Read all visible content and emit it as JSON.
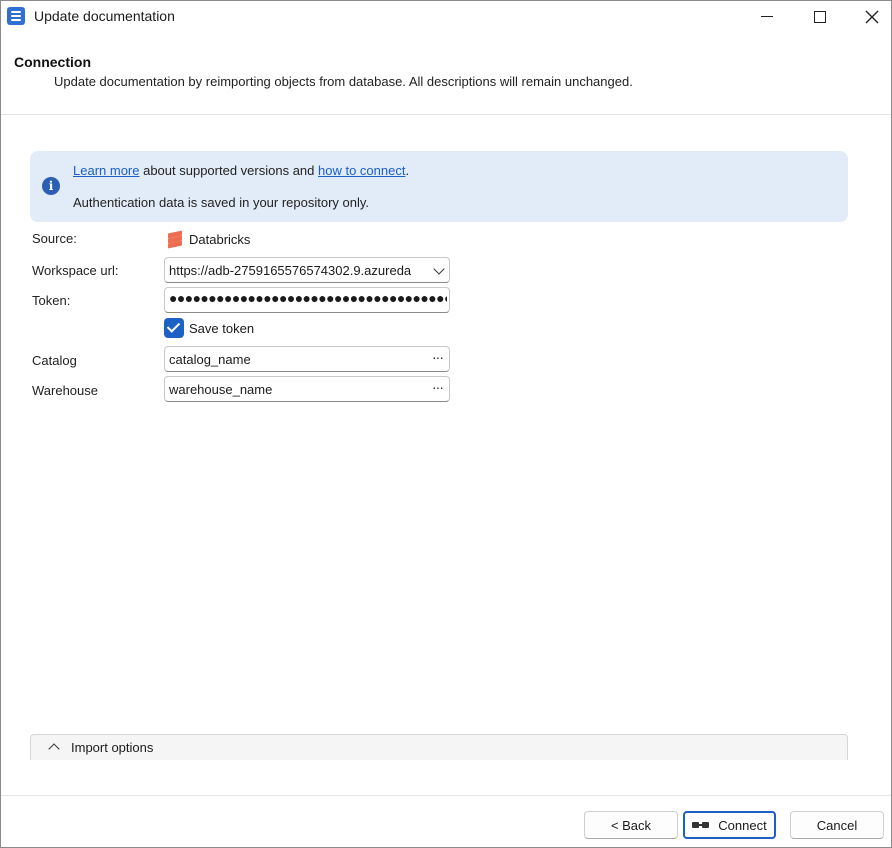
{
  "window": {
    "title": "Update documentation",
    "icon": "document-database-icon"
  },
  "header": {
    "title": "Connection",
    "subtitle": "Update documentation by reimporting objects from database. All descriptions will remain unchanged."
  },
  "info": {
    "link_learn_more": "Learn more",
    "text_middle": " about supported versions and ",
    "link_how_to_connect": "how to connect",
    "text_end": ".",
    "note": "Authentication data is saved in your repository only."
  },
  "form": {
    "source": {
      "label": "Source:",
      "value": "Databricks",
      "icon": "databricks-icon"
    },
    "workspace_url": {
      "label": "Workspace url:",
      "value": "https://adb-2759165576574302.9.azureda"
    },
    "token": {
      "label": "Token:",
      "value": "●●●●●●●●●●●●●●●●●●●●●●●●●●●●●●●●●●●●"
    },
    "save_token": {
      "label": "Save token",
      "checked": true
    },
    "catalog": {
      "label": "Catalog",
      "value": "catalog_name",
      "browse": "···"
    },
    "warehouse": {
      "label": "Warehouse",
      "value": "warehouse_name",
      "browse": "···"
    }
  },
  "import_options": {
    "label": "Import options"
  },
  "footer": {
    "back_label": "< Back",
    "connect_label": "Connect",
    "cancel_label": "Cancel"
  },
  "colors": {
    "accent": "#1b62c4",
    "info_background": "#e2ebf8",
    "databricks": "#ec6d4f"
  }
}
